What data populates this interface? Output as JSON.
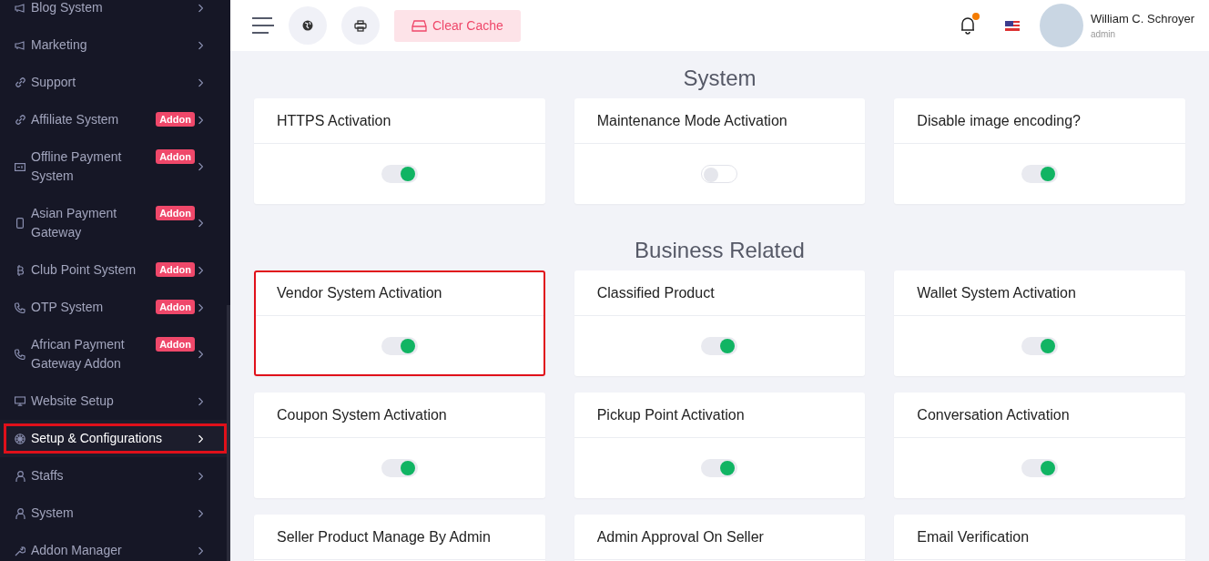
{
  "sidebar": {
    "items": [
      {
        "label": "Blog System",
        "highlighted": false
      },
      {
        "label": "Marketing",
        "highlighted": false
      },
      {
        "label": "Support",
        "highlighted": false
      },
      {
        "label": "Affiliate System",
        "badge": "Addon",
        "highlighted": false
      },
      {
        "label": "Offline Payment System",
        "badge": "Addon",
        "highlighted": false
      },
      {
        "label": "Asian Payment Gateway",
        "badge": "Addon",
        "highlighted": false
      },
      {
        "label": "Club Point System",
        "badge": "Addon",
        "highlighted": false
      },
      {
        "label": "OTP System",
        "badge": "Addon",
        "highlighted": false
      },
      {
        "label": "African Payment Gateway Addon",
        "badge": "Addon",
        "highlighted": false
      },
      {
        "label": "Website Setup",
        "highlighted": false
      },
      {
        "label": "Setup & Configurations",
        "highlighted": true
      },
      {
        "label": "Staffs",
        "highlighted": false
      },
      {
        "label": "System",
        "highlighted": false
      },
      {
        "label": "Addon Manager",
        "highlighted": false
      }
    ]
  },
  "header": {
    "clear_cache": "Clear Cache",
    "notification_dot": true,
    "user": {
      "name": "William C. Schroyer",
      "role": "admin"
    }
  },
  "sections": [
    {
      "title": "System",
      "cards": [
        {
          "title": "HTTPS Activation",
          "on": true,
          "highlighted": false
        },
        {
          "title": "Maintenance Mode Activation",
          "on": false,
          "highlighted": false
        },
        {
          "title": "Disable image encoding?",
          "on": true,
          "highlighted": false
        }
      ]
    },
    {
      "title": "Business Related",
      "cards": [
        {
          "title": "Vendor System Activation",
          "on": true,
          "highlighted": true
        },
        {
          "title": "Classified Product",
          "on": true,
          "highlighted": false
        },
        {
          "title": "Wallet System Activation",
          "on": true,
          "highlighted": false
        },
        {
          "title": "Coupon System Activation",
          "on": true,
          "highlighted": false
        },
        {
          "title": "Pickup Point Activation",
          "on": true,
          "highlighted": false
        },
        {
          "title": "Conversation Activation",
          "on": true,
          "highlighted": false
        },
        {
          "title": "Seller Product Manage By Admin",
          "highlighted": false
        },
        {
          "title": "Admin Approval On Seller",
          "highlighted": false
        },
        {
          "title": "Email Verification",
          "highlighted": false
        }
      ]
    }
  ]
}
